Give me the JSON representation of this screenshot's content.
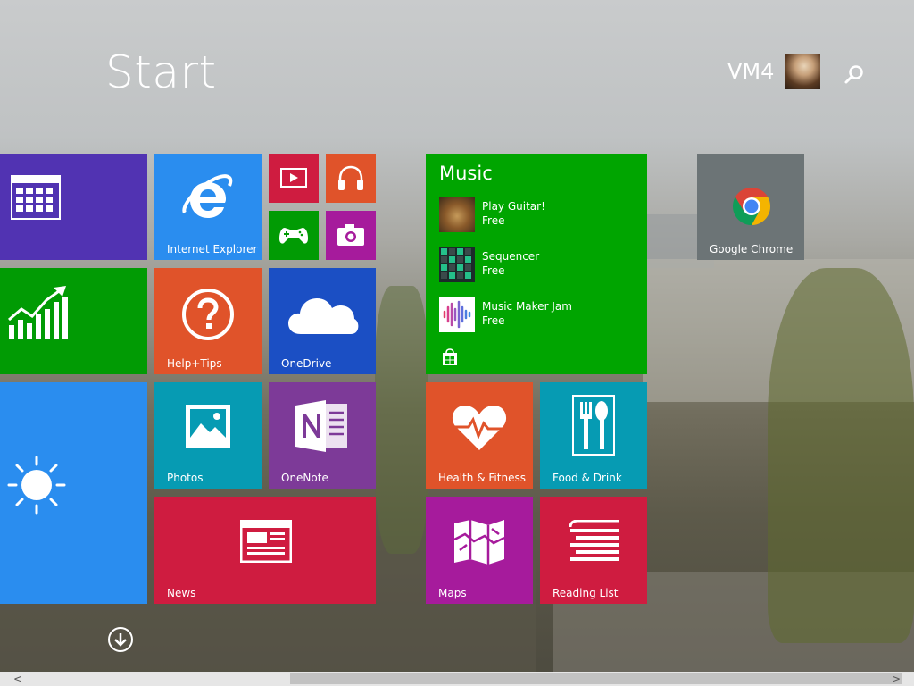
{
  "header": {
    "title": "Start",
    "user_name": "VM4"
  },
  "icons": {
    "search": "search-icon",
    "avatar": "user-avatar",
    "scroll_down": "arrow-down-circle-icon"
  },
  "colors": {
    "purple": "#5133b2",
    "green": "#019b04",
    "blue": "#2a8def",
    "orange": "#e0532a",
    "darkblue": "#1b4fc4",
    "red": "#cf1c40",
    "magenta": "#a61b9c",
    "teal": "#069bb3",
    "onenote": "#7d3a98",
    "music_green": "#00a500",
    "chrome_gray": "#6c7476"
  },
  "tiles": {
    "calendar": {
      "label": ""
    },
    "finance": {
      "label": ""
    },
    "weather": {
      "label": ""
    },
    "internet_explorer": {
      "label": "Internet Explorer"
    },
    "video": {
      "label": ""
    },
    "music_small": {
      "label": ""
    },
    "games": {
      "label": ""
    },
    "camera": {
      "label": ""
    },
    "help_tips": {
      "label": "Help+Tips"
    },
    "onedrive": {
      "label": "OneDrive"
    },
    "photos": {
      "label": "Photos"
    },
    "onenote": {
      "label": "OneNote"
    },
    "news": {
      "label": "News"
    },
    "music": {
      "title": "Music",
      "items": [
        {
          "name": "Play Guitar!",
          "price": "Free"
        },
        {
          "name": "Sequencer",
          "price": "Free"
        },
        {
          "name": "Music Maker Jam",
          "price": "Free"
        }
      ]
    },
    "health_fitness": {
      "label": "Health & Fitness"
    },
    "food_drink": {
      "label": "Food & Drink"
    },
    "maps": {
      "label": "Maps"
    },
    "reading_list": {
      "label": "Reading List"
    },
    "google_chrome": {
      "label": "Google Chrome"
    }
  },
  "scrollbar": {
    "left_arrow": "<",
    "right_arrow": ">"
  }
}
